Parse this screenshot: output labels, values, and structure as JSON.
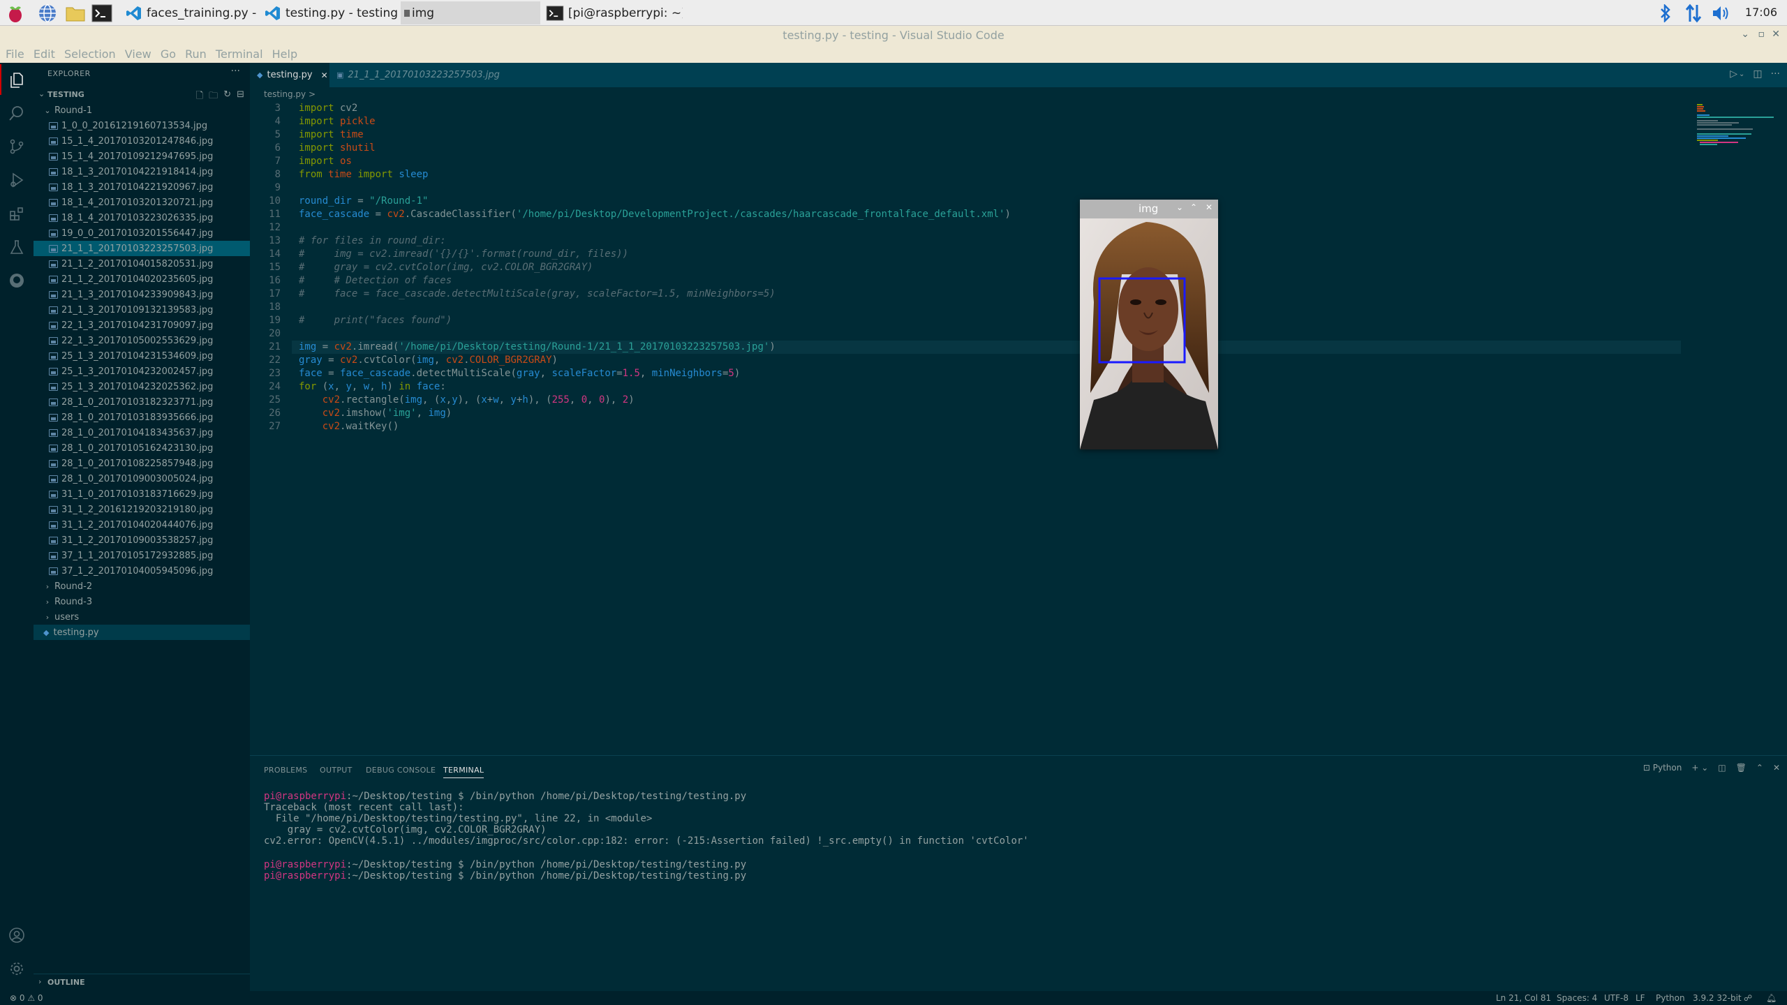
{
  "taskbar": {
    "tasks": [
      {
        "label": "faces_training.py - D..."
      },
      {
        "label": "testing.py - testing - ..."
      },
      {
        "label": "img"
      },
      {
        "label": "[pi@raspberrypi: ~]"
      }
    ],
    "clock": "17:06"
  },
  "window": {
    "title": "testing.py - testing - Visual Studio Code"
  },
  "menu": [
    "File",
    "Edit",
    "Selection",
    "View",
    "Go",
    "Run",
    "Terminal",
    "Help"
  ],
  "sidebar": {
    "header": "EXPLORER",
    "section": "TESTING",
    "folder": "Round-1",
    "files": [
      "1_0_0_20161219160713534.jpg",
      "15_1_4_20170103201247846.jpg",
      "15_1_4_20170109212947695.jpg",
      "18_1_3_20170104221918414.jpg",
      "18_1_3_20170104221920967.jpg",
      "18_1_4_20170103201320721.jpg",
      "18_1_4_20170103223026335.jpg",
      "19_0_0_20170103201556447.jpg",
      "21_1_1_20170103223257503.jpg",
      "21_1_2_20170104015820531.jpg",
      "21_1_2_20170104020235605.jpg",
      "21_1_3_20170104233909843.jpg",
      "21_1_3_20170109132139583.jpg",
      "22_1_3_20170104231709097.jpg",
      "22_1_3_20170105002553629.jpg",
      "25_1_3_20170104231534609.jpg",
      "25_1_3_20170104232002457.jpg",
      "25_1_3_20170104232025362.jpg",
      "28_1_0_20170103182323771.jpg",
      "28_1_0_20170103183935666.jpg",
      "28_1_0_20170104183435637.jpg",
      "28_1_0_20170105162423130.jpg",
      "28_1_0_20170108225857948.jpg",
      "28_1_0_20170109003005024.jpg",
      "31_1_0_20170103183716629.jpg",
      "31_1_2_20161219203219180.jpg",
      "31_1_2_20170104020444076.jpg",
      "31_1_2_20170109003538257.jpg",
      "37_1_1_20170105172932885.jpg",
      "37_1_2_20170104005945096.jpg"
    ],
    "folders": [
      "Round-2",
      "Round-3",
      "users"
    ],
    "active_file": "testing.py",
    "outline": "OUTLINE"
  },
  "tabs": [
    {
      "label": "testing.py"
    },
    {
      "label": "21_1_1_20170103223257503.jpg"
    }
  ],
  "breadcrumb": "testing.py >",
  "code": {
    "line_numbers": [
      "3",
      "4",
      "5",
      "6",
      "7",
      "8",
      "9",
      "10",
      "11",
      "12",
      "13",
      "14",
      "15",
      "16",
      "17",
      "18",
      "19",
      "20",
      "21",
      "22",
      "23",
      "24",
      "25",
      "26",
      "27"
    ]
  },
  "img_window": {
    "title": "img"
  },
  "panel": {
    "tabs": [
      "PROBLEMS",
      "OUTPUT",
      "DEBUG CONSOLE",
      "TERMINAL"
    ],
    "shell": "Python",
    "terminal": [
      {
        "prompt": "pi@raspberrypi",
        "rest": ":~/Desktop/testing $ /bin/python /home/pi/Desktop/testing/testing.py"
      },
      {
        "prompt": "",
        "rest": "Traceback (most recent call last):"
      },
      {
        "prompt": "",
        "rest": "  File \"/home/pi/Desktop/testing/testing.py\", line 22, in <module>"
      },
      {
        "prompt": "",
        "rest": "    gray = cv2.cvtColor(img, cv2.COLOR_BGR2GRAY)"
      },
      {
        "prompt": "",
        "rest": "cv2.error: OpenCV(4.5.1) ../modules/imgproc/src/color.cpp:182: error: (-215:Assertion failed) !_src.empty() in function 'cvtColor'"
      },
      {
        "prompt": "",
        "rest": ""
      },
      {
        "prompt": "pi@raspberrypi",
        "rest": ":~/Desktop/testing $ /bin/python /home/pi/Desktop/testing/testing.py"
      },
      {
        "prompt": "pi@raspberrypi",
        "rest": ":~/Desktop/testing $ /bin/python /home/pi/Desktop/testing/testing.py"
      }
    ]
  },
  "status": {
    "problems": "⊗ 0 ⚠ 0",
    "position": "Ln 21, Col 81",
    "spaces": "Spaces: 4",
    "encoding": "UTF-8",
    "eol": "LF",
    "language": "Python",
    "interpreter": "3.9.2 32-bit"
  }
}
